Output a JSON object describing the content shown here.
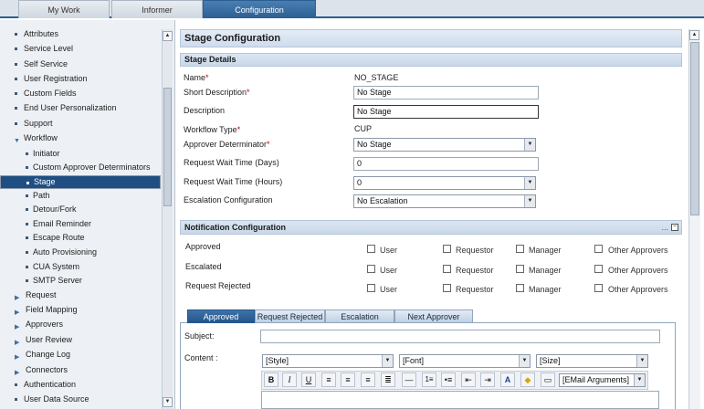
{
  "top_tabs": [
    {
      "label": "My Work"
    },
    {
      "label": "Informer"
    },
    {
      "label": "Configuration"
    }
  ],
  "sidebar": {
    "items": [
      {
        "label": "Attributes"
      },
      {
        "label": "Service Level"
      },
      {
        "label": "Self Service"
      },
      {
        "label": "User Registration"
      },
      {
        "label": "Custom Fields"
      },
      {
        "label": "End User Personalization"
      },
      {
        "label": "Support"
      },
      {
        "label": "Workflow"
      },
      {
        "label": "Initiator"
      },
      {
        "label": "Custom Approver Determinators"
      },
      {
        "label": "Stage"
      },
      {
        "label": "Path"
      },
      {
        "label": "Detour/Fork"
      },
      {
        "label": "Email Reminder"
      },
      {
        "label": "Escape Route"
      },
      {
        "label": "Auto Provisioning"
      },
      {
        "label": "CUA System"
      },
      {
        "label": "SMTP Server"
      },
      {
        "label": "Request"
      },
      {
        "label": "Field Mapping"
      },
      {
        "label": "Approvers"
      },
      {
        "label": "User Review"
      },
      {
        "label": "Change Log"
      },
      {
        "label": "Connectors"
      },
      {
        "label": "Authentication"
      },
      {
        "label": "User Data Source"
      }
    ]
  },
  "main": {
    "title": "Stage Configuration",
    "details_header": "Stage Details",
    "fields": {
      "name_label": "Name",
      "name_value": "NO_STAGE",
      "short_desc_label": "Short Description",
      "short_desc_value": "No Stage",
      "desc_label": "Description",
      "desc_value": "No Stage",
      "workflow_type_label": "Workflow Type",
      "workflow_type_value": "CUP",
      "approver_det_label": "Approver Determinator",
      "approver_det_value": "No Stage",
      "wait_days_label": "Request Wait Time (Days)",
      "wait_days_value": "0",
      "wait_hours_label": "Request Wait Time (Hours)",
      "wait_hours_value": "0",
      "escalation_label": "Escalation Configuration",
      "escalation_value": "No Escalation"
    },
    "notif_header": "Notification Configuration",
    "notif_rows": [
      {
        "label": "Approved"
      },
      {
        "label": "Escalated"
      },
      {
        "label": "Request Rejected"
      }
    ],
    "notif_cols": [
      {
        "label": "User"
      },
      {
        "label": "Requestor"
      },
      {
        "label": "Manager"
      },
      {
        "label": "Other Approvers"
      }
    ],
    "bottom_tabs": [
      {
        "label": "Approved"
      },
      {
        "label": "Request Rejected"
      },
      {
        "label": "Escalation"
      },
      {
        "label": "Next Approver"
      }
    ],
    "subject_label": "Subject:",
    "content_label": "Content :",
    "editor": {
      "style": "[Style]",
      "font": "[Font]",
      "size": "[Size]",
      "email_args": "[EMail Arguments]"
    },
    "toolbar": {
      "bold": "B",
      "italic": "I",
      "underline": "U"
    }
  }
}
